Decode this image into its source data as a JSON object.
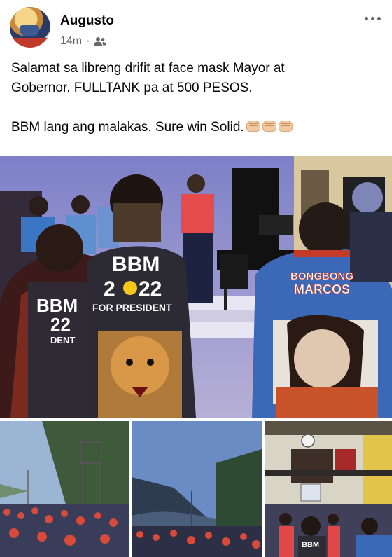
{
  "post": {
    "author": "Augusto",
    "time": "14m",
    "separator": "·",
    "audience_icon": "friends-icon",
    "caption_line1": "Salamat sa libreng drifit at face mask Mayor at",
    "caption_line2": "Gobernor. FULLTANK pa at 500 PESOS.",
    "caption_line3": "BBM lang ang malakas. Sure win Solid.",
    "emoji": "fist-emoji"
  },
  "photo_text": {
    "shirt_left_brand": "BBM",
    "shirt_left_year": "22",
    "shirt_left_sub": "DENT",
    "shirt_center_brand": "BBM",
    "shirt_center_year_a": "2",
    "shirt_center_year_b": "22",
    "shirt_center_sub": "FOR PRESIDENT",
    "shirt_right_line1": "BONGBONG",
    "shirt_right_line2": "MARCOS",
    "thumb3_shirt": "BBM"
  },
  "colors": {
    "text_primary": "#050505",
    "text_secondary": "#65676b"
  }
}
